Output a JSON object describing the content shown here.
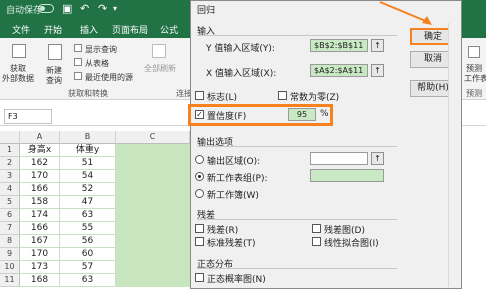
{
  "titlebar": {
    "autosave": "自动保存"
  },
  "tabs": [
    "文件",
    "开始",
    "插入",
    "页面布局",
    "公式"
  ],
  "ribbon": {
    "get_data_1": "获取",
    "get_data_2": "外部数据",
    "new_query_1": "新建",
    "new_query_2": "查询",
    "show_queries": "显示查询",
    "from_table": "从表格",
    "recent_sources": "最近使用的源",
    "group_label": "获取和转换",
    "refresh_all": "全部刷新",
    "connections": "连接",
    "forecast_1": "预测",
    "forecast_2": "工作表",
    "forecast_group": "预测"
  },
  "namebox": {
    "value": "F3"
  },
  "columns": [
    "A",
    "B",
    "C"
  ],
  "rows": [
    {
      "n": "1",
      "a": "身高x",
      "b": "体重y"
    },
    {
      "n": "2",
      "a": "162",
      "b": "51"
    },
    {
      "n": "3",
      "a": "170",
      "b": "54"
    },
    {
      "n": "4",
      "a": "166",
      "b": "52"
    },
    {
      "n": "5",
      "a": "158",
      "b": "47"
    },
    {
      "n": "6",
      "a": "174",
      "b": "63"
    },
    {
      "n": "7",
      "a": "166",
      "b": "55"
    },
    {
      "n": "8",
      "a": "167",
      "b": "56"
    },
    {
      "n": "9",
      "a": "170",
      "b": "60"
    },
    {
      "n": "10",
      "a": "173",
      "b": "57"
    },
    {
      "n": "11",
      "a": "168",
      "b": "63"
    }
  ],
  "dialog": {
    "title": "回归",
    "input_section": "输入",
    "y_range_label": "Y 值输入区域(Y):",
    "y_range_value": "$B$2:$B$11",
    "x_range_label": "X 值输入区域(X):",
    "x_range_value": "$A$2:$A$11",
    "labels": "标志(L)",
    "const_zero": "常数为零(Z)",
    "confidence": "置信度(F)",
    "confidence_value": "95",
    "percent": "%",
    "output_section": "输出选项",
    "output_range": "输出区域(O):",
    "new_ws_ply": "新工作表组(P):",
    "new_workbook": "新工作簿(W)",
    "residuals_section": "残差",
    "residuals": "残差(R)",
    "residual_plots": "残差图(D)",
    "std_residuals": "标准残差(T)",
    "line_fit_plots": "线性拟合图(I)",
    "normal_section": "正态分布",
    "normal_plots": "正态概率图(N)",
    "ok": "确定",
    "cancel": "取消",
    "help": "帮助(H)"
  },
  "colors": {
    "excel_green": "#217346",
    "highlight_orange": "#f5821f",
    "selection_green": "#c7e6c0"
  }
}
